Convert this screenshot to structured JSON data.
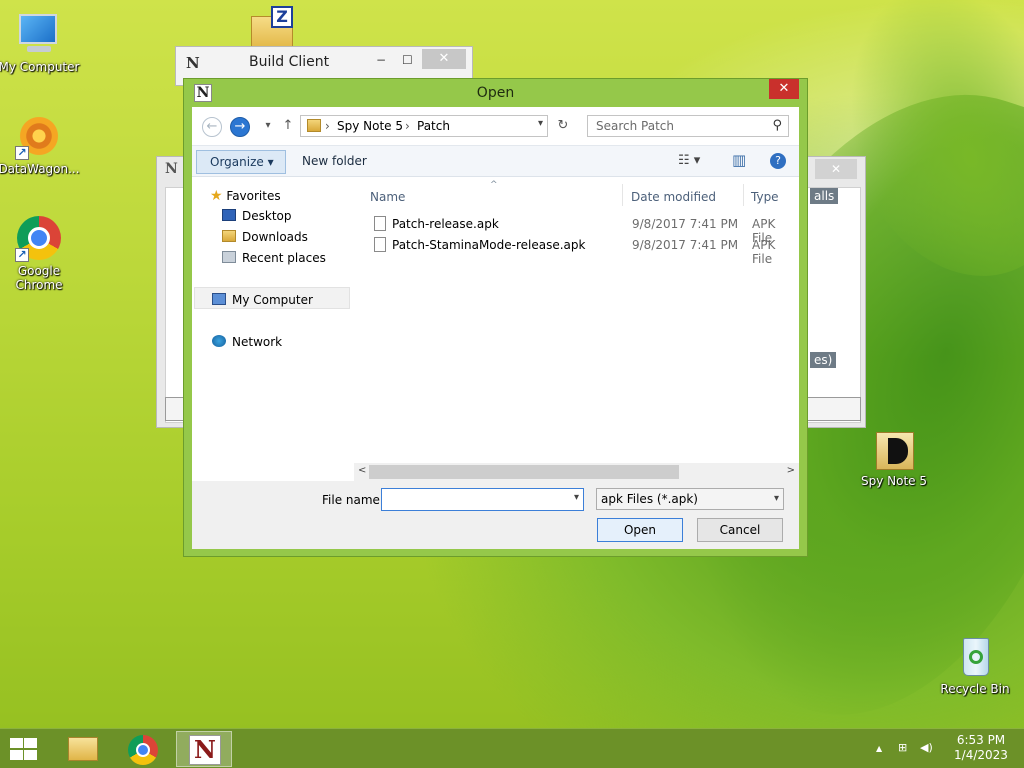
{
  "desktop": {
    "icons": [
      {
        "label": "My Computer"
      },
      {
        "label": "DataWagon..."
      },
      {
        "label": "Google Chrome"
      },
      {
        "label": "Spy Note 5"
      },
      {
        "label": "Recycle Bin"
      }
    ]
  },
  "build_client": {
    "app_letter": "N",
    "title": "Build Client",
    "minimize": "−",
    "maximize": "☐",
    "close": "✕"
  },
  "background_window": {
    "app_letter": "N",
    "close": "✕",
    "tag_calls": "alls",
    "tag_es": "es)"
  },
  "open_dialog": {
    "app_letter": "N",
    "title": "Open",
    "close": "✕",
    "nav": {
      "back": "←",
      "forward": "→",
      "history": "▾",
      "up": "↑",
      "breadcrumb": [
        "Spy Note 5",
        "Patch"
      ],
      "crumb_sep": "›",
      "address_dropdown": "▾",
      "refresh": "↻",
      "search_placeholder": "Search Patch",
      "search_icon": "⚲"
    },
    "toolbar": {
      "organize": "Organize ▾",
      "new_folder": "New folder",
      "views_icon": "☷ ▾",
      "preview_icon": "▥",
      "help_icon": "?"
    },
    "nav_pane": {
      "favorites": "Favorites",
      "favorites_items": [
        "Desktop",
        "Downloads",
        "Recent places"
      ],
      "my_computer": "My Computer",
      "network": "Network"
    },
    "columns": {
      "name": "Name",
      "date_modified": "Date modified",
      "type": "Type",
      "sort_arrow": "^"
    },
    "files": [
      {
        "name": "Patch-release.apk",
        "date": "9/8/2017 7:41 PM",
        "type": "APK File"
      },
      {
        "name": "Patch-StaminaMode-release.apk",
        "date": "9/8/2017 7:41 PM",
        "type": "APK File"
      }
    ],
    "scroll": {
      "left": "<",
      "right": ">"
    },
    "file_name_label": "File name:",
    "file_name_value": "",
    "file_name_dropdown": "▾",
    "filter": "apk Files (*.apk)",
    "filter_dropdown": "▾",
    "open_button": "Open",
    "cancel_button": "Cancel"
  },
  "taskbar": {
    "tray": {
      "chevron": "▲",
      "network": "⊞",
      "volume": "◀)"
    },
    "time": "6:53 PM",
    "date": "1/4/2023"
  }
}
